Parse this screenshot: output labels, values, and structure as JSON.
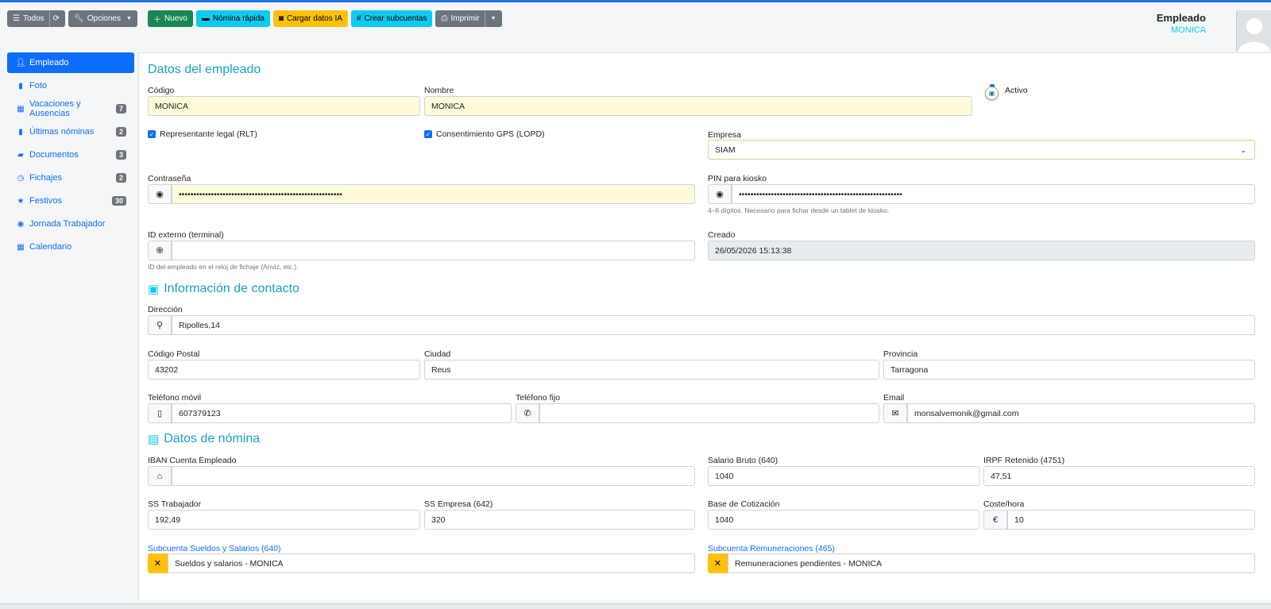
{
  "toolbar": {
    "todos": "Todos",
    "opciones": "Opciones",
    "nuevo": "Nuevo",
    "nomina_rapida": "Nómina rápida",
    "cargar_ia": "Cargar datos IA",
    "crear_subcuentas": "Crear subcuentas",
    "imprimir": "Imprimir"
  },
  "user": {
    "role": "Empleado",
    "name": "MONICA"
  },
  "sidebar": {
    "items": [
      {
        "label": "Empleado"
      },
      {
        "label": "Foto"
      },
      {
        "label": "Vacaciones y Ausencias",
        "badge": "7"
      },
      {
        "label": "Últimas nóminas",
        "badge": "2"
      },
      {
        "label": "Documentos",
        "badge": "3"
      },
      {
        "label": "Fichajes",
        "badge": "2"
      },
      {
        "label": "Festivos",
        "badge": "30"
      },
      {
        "label": "Jornada Trabajador"
      },
      {
        "label": "Calendario"
      }
    ]
  },
  "empleado": {
    "title": "Datos del empleado",
    "codigo_label": "Código",
    "codigo": "MONICA",
    "nombre_label": "Nombre",
    "nombre": "MONICA",
    "activo_label": "Activo",
    "rlt_label": "Representante legal (RLT)",
    "gps_label": "Consentimiento GPS (LOPD)",
    "empresa_label": "Empresa",
    "empresa": "SIAM",
    "password_label": "Contraseña",
    "password": "••••••••••••••••••••••••••••••••••••••••••••••••••••••••",
    "pin_label": "PIN para kiosko",
    "pin": "••••••••••••••••••••••••••••••••••••••••••••••••••••••••",
    "pin_help": "4–6 dígitos. Necesario para fichar desde un tablet de kiosko.",
    "idext_label": "ID externo (terminal)",
    "idext": "",
    "idext_help": "ID del empleado en el reloj de fichaje (Anviz, etc.).",
    "creado_label": "Creado",
    "creado": "26/05/2026 15:13:38"
  },
  "contacto": {
    "title": "Información de contacto",
    "direccion_label": "Dirección",
    "direccion": "Ripolles,14",
    "cp_label": "Código Postal",
    "cp": "43202",
    "ciudad_label": "Ciudad",
    "ciudad": "Reus",
    "provincia_label": "Provincia",
    "provincia": "Tarragona",
    "movil_label": "Teléfono móvil",
    "movil": "607379123",
    "fijo_label": "Teléfono fijo",
    "fijo": "",
    "email_label": "Email",
    "email": "monsalvemonik@gmail.com"
  },
  "nomina": {
    "title": "Datos de nómina",
    "iban_label": "IBAN Cuenta Empleado",
    "iban": "",
    "salario_label": "Salario Bruto (640)",
    "salario": "1040",
    "irpf_label": "IRPF Retenido (4751)",
    "irpf": "47,51",
    "ss_trab_label": "SS Trabajador",
    "ss_trab": "192,49",
    "ss_emp_label": "SS Empresa (642)",
    "ss_emp": "320",
    "base_label": "Base de Cotización",
    "base": "1040",
    "coste_label": "Coste/hora",
    "coste": "10",
    "sub_sueldos_label": "Subcuenta Sueldos y Salarios (640)",
    "sub_sueldos": "Sueldos y salarios - MONICA",
    "sub_remun_label": "Subcuenta Remuneraciones (465)",
    "sub_remun": "Remuneraciones pendientes - MONICA"
  }
}
